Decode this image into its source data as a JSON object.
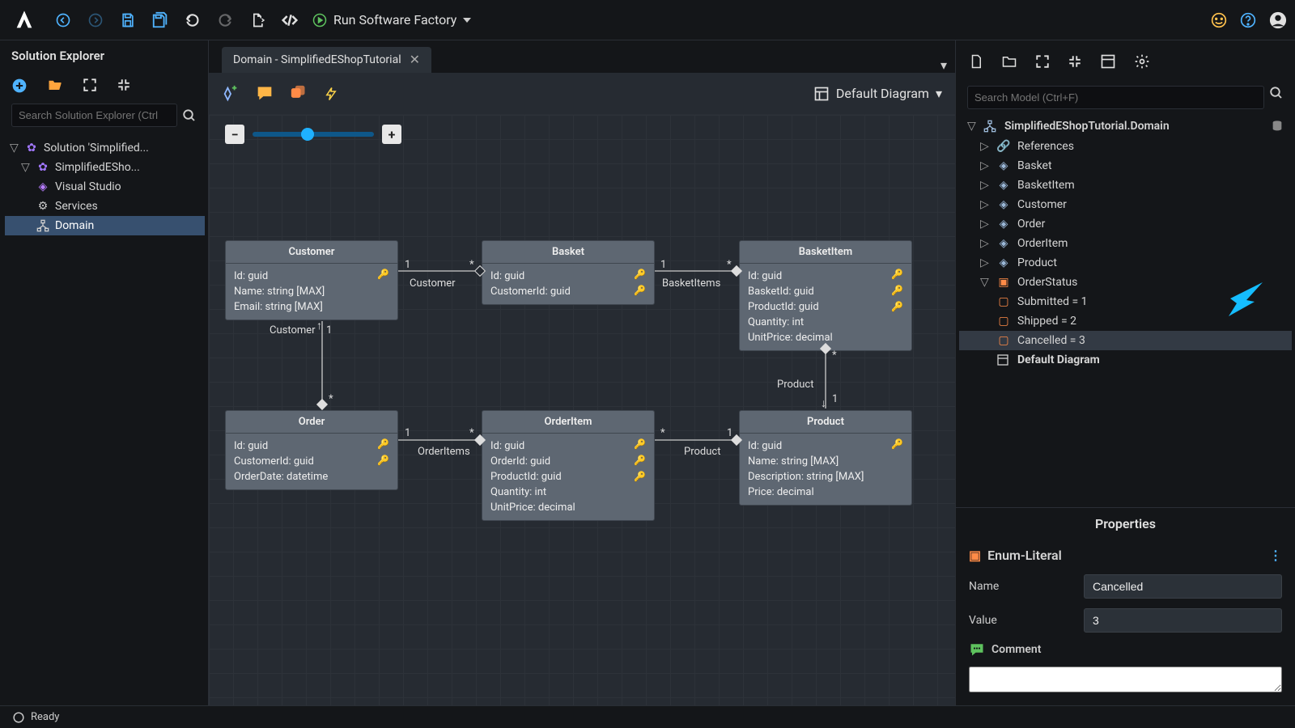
{
  "toolbar": {
    "run_label": "Run Software Factory"
  },
  "explorer": {
    "title": "Solution Explorer",
    "search_placeholder": "Search Solution Explorer (Ctrl",
    "tree": {
      "root": "Solution 'Simplified...",
      "project": "SimplifiedESho...",
      "items": [
        "Visual Studio",
        "Services",
        "Domain"
      ]
    }
  },
  "tab": {
    "label": "Domain - SimplifiedEShopTutorial"
  },
  "diagram": {
    "selector_label": "Default Diagram",
    "entities": {
      "customer": {
        "name": "Customer",
        "attrs": [
          "Id: guid",
          "Name: string [MAX]",
          "Email: string [MAX]"
        ]
      },
      "basket": {
        "name": "Basket",
        "attrs": [
          "Id: guid",
          "CustomerId: guid"
        ]
      },
      "basketitem": {
        "name": "BasketItem",
        "attrs": [
          "Id: guid",
          "BasketId: guid",
          "ProductId: guid",
          "Quantity: int",
          "UnitPrice: decimal"
        ]
      },
      "order": {
        "name": "Order",
        "attrs": [
          "Id: guid",
          "CustomerId: guid",
          "OrderDate: datetime"
        ]
      },
      "orderitem": {
        "name": "OrderItem",
        "attrs": [
          "Id: guid",
          "OrderId: guid",
          "ProductId: guid",
          "Quantity: int",
          "UnitPrice: decimal"
        ]
      },
      "product": {
        "name": "Product",
        "attrs": [
          "Id: guid",
          "Name: string [MAX]",
          "Description: string [MAX]",
          "Price: decimal"
        ]
      }
    },
    "labels": {
      "customer": "Customer",
      "basketitems": "BasketItems",
      "orderitems": "OrderItems",
      "product": "Product"
    },
    "card": {
      "one": "1",
      "many": "*"
    }
  },
  "model": {
    "search_placeholder": "Search Model (Ctrl+F)",
    "root": "SimplifiedEShopTutorial.Domain",
    "refs": "References",
    "items": [
      "Basket",
      "BasketItem",
      "Customer",
      "Order",
      "OrderItem",
      "Product"
    ],
    "enum_name": "OrderStatus",
    "enum_values": [
      "Submitted  =  1",
      "Shipped  =  2",
      "Cancelled  =  3"
    ],
    "default_diagram": "Default Diagram"
  },
  "props": {
    "title": "Properties",
    "type": "Enum-Literal",
    "name_label": "Name",
    "value_label": "Value",
    "comment_label": "Comment",
    "name_value": "Cancelled",
    "value_value": "3"
  },
  "status": {
    "text": "Ready"
  }
}
